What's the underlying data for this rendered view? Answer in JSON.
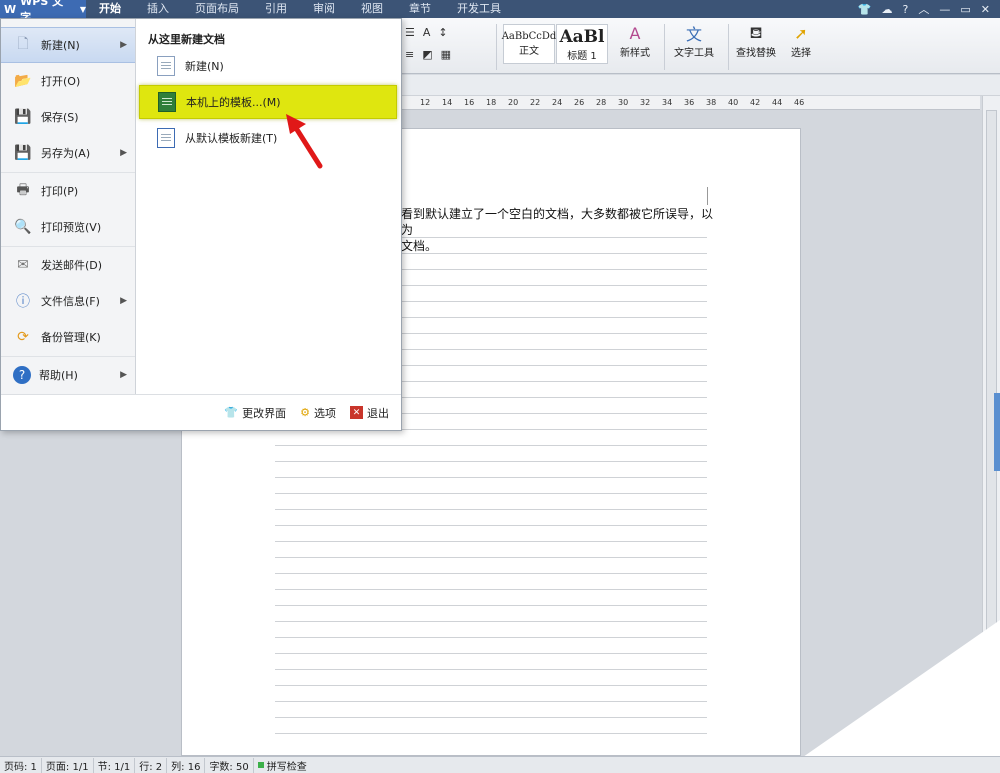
{
  "titlebar": {
    "app_name": "WPS 文字",
    "tabs": [
      "开始",
      "插入",
      "页面布局",
      "引用",
      "审阅",
      "视图",
      "章节",
      "开发工具"
    ],
    "help_label": "?"
  },
  "ribbon": {
    "style_normal_sample": "AaBbCcDd",
    "style_normal_label": "正文",
    "style_heading_sample": "AaBl",
    "style_heading_label": "标题 1",
    "new_style_label": "新样式",
    "text_tools_label": "文字工具",
    "find_replace_label": "查找替换",
    "select_label": "选择"
  },
  "ruler": {
    "ticks": [
      "12",
      "14",
      "16",
      "18",
      "20",
      "22",
      "24",
      "26",
      "28",
      "30",
      "32",
      "34",
      "36",
      "38",
      "40",
      "42",
      "44",
      "46"
    ]
  },
  "document": {
    "line1": "看到默认建立了一个空白的文档，大多数都被它所误导，以为",
    "line2": "文档。"
  },
  "file_menu": {
    "items": [
      {
        "label": "新建(N)",
        "icon": "new-doc-icon"
      },
      {
        "label": "打开(O)",
        "icon": "folder-open-icon"
      },
      {
        "label": "保存(S)",
        "icon": "save-icon"
      },
      {
        "label": "另存为(A)",
        "icon": "save-as-icon"
      },
      {
        "label": "打印(P)",
        "icon": "print-icon"
      },
      {
        "label": "打印预览(V)",
        "icon": "print-preview-icon"
      },
      {
        "label": "发送邮件(D)",
        "icon": "mail-icon"
      },
      {
        "label": "文件信息(F)",
        "icon": "file-info-icon"
      },
      {
        "label": "备份管理(K)",
        "icon": "backup-icon"
      },
      {
        "label": "帮助(H)",
        "icon": "help-icon"
      }
    ],
    "submenu_title": "从这里新建文档",
    "submenu": [
      {
        "label": "新建(N)"
      },
      {
        "label": "本机上的模板...(M)"
      },
      {
        "label": "从默认模板新建(T)"
      }
    ],
    "footer": {
      "change_ui": "更改界面",
      "options": "选项",
      "exit": "退出"
    }
  },
  "statusbar": {
    "page_num": "页码: 1",
    "pages": "页面: 1/1",
    "section": "节: 1/1",
    "row": "行: 2",
    "col": "列: 16",
    "word_count": "字数: 50",
    "spell_check": "拼写检查"
  },
  "colors": {
    "highlight": "#dfe60f",
    "titlebar": "#3c5476",
    "app_button": "#3d6bb3",
    "arrow": "#e01818"
  }
}
